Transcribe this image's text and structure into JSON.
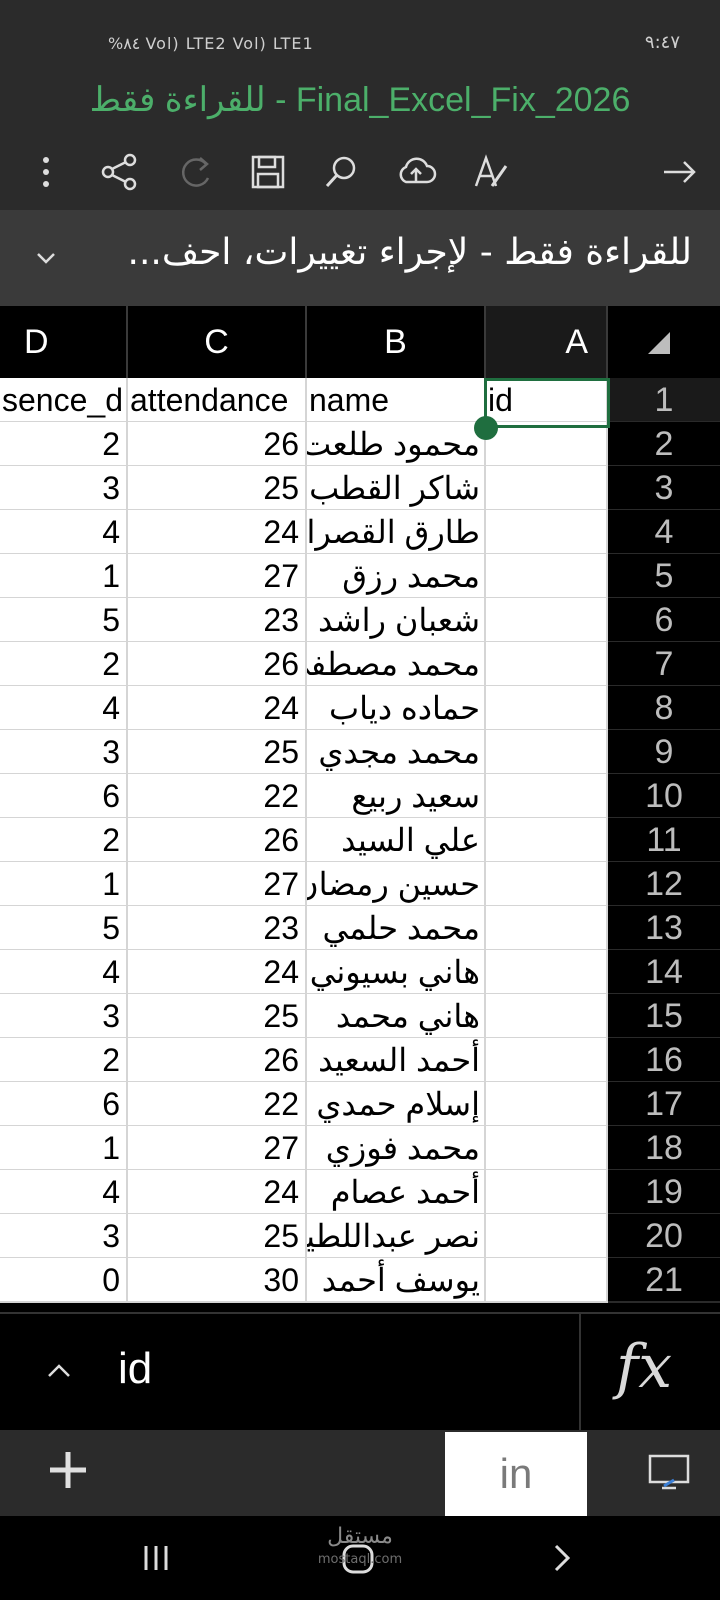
{
  "status": {
    "left_text": "%٨٤ Vol) LTE2 Vol) LTE1",
    "time": "٩:٤٧"
  },
  "app": {
    "title": "للقراءة فقط - Final_Excel_Fix_2026"
  },
  "notice": {
    "text": "للقراءة فقط - لإجراء تغييرات، احف..."
  },
  "columns": [
    "D",
    "C",
    "B",
    "A"
  ],
  "header_row": {
    "row": "1",
    "A": "id",
    "B": "name",
    "C": "attendance",
    "D": "sence_d"
  },
  "rows": [
    {
      "row": "2",
      "B": "محمود طلعت",
      "C": "26",
      "D": "2"
    },
    {
      "row": "3",
      "B": "شاكر القطب",
      "C": "25",
      "D": "3"
    },
    {
      "row": "4",
      "B": "طارق القصراو",
      "C": "24",
      "D": "4"
    },
    {
      "row": "5",
      "B": "محمد رزق",
      "C": "27",
      "D": "1"
    },
    {
      "row": "6",
      "B": "شعبان راشد",
      "C": "23",
      "D": "5"
    },
    {
      "row": "7",
      "B": "محمد مصطفى",
      "C": "26",
      "D": "2"
    },
    {
      "row": "8",
      "B": "حماده دياب",
      "C": "24",
      "D": "4"
    },
    {
      "row": "9",
      "B": "محمد مجدي",
      "C": "25",
      "D": "3"
    },
    {
      "row": "10",
      "B": "سعيد ربيع",
      "C": "22",
      "D": "6"
    },
    {
      "row": "11",
      "B": "علي السيد",
      "C": "26",
      "D": "2"
    },
    {
      "row": "12",
      "B": "حسين رمضان",
      "C": "27",
      "D": "1"
    },
    {
      "row": "13",
      "B": "محمد حلمي",
      "C": "23",
      "D": "5"
    },
    {
      "row": "14",
      "B": "هاني بسيوني",
      "C": "24",
      "D": "4"
    },
    {
      "row": "15",
      "B": "هاني محمد",
      "C": "25",
      "D": "3"
    },
    {
      "row": "16",
      "B": "أحمد السعيد",
      "C": "26",
      "D": "2"
    },
    {
      "row": "17",
      "B": "إسلام حمدي",
      "C": "22",
      "D": "6"
    },
    {
      "row": "18",
      "B": "محمد فوزي",
      "C": "27",
      "D": "1"
    },
    {
      "row": "19",
      "B": "أحمد عصام",
      "C": "24",
      "D": "4"
    },
    {
      "row": "20",
      "B": "نصر عبداللطيف",
      "C": "25",
      "D": "3"
    },
    {
      "row": "21",
      "B": "يوسف أحمد",
      "C": "30",
      "D": "0"
    }
  ],
  "formula_bar": {
    "value": "id",
    "fx_label": "fx"
  },
  "sheet": {
    "tab_label": "in"
  },
  "watermark": {
    "text": "مستقل",
    "sub": "mostaql.com"
  },
  "colors": {
    "accent": "#1f6e3f",
    "title_green": "#4caf6a",
    "bar_bg": "#2b2b2b"
  }
}
